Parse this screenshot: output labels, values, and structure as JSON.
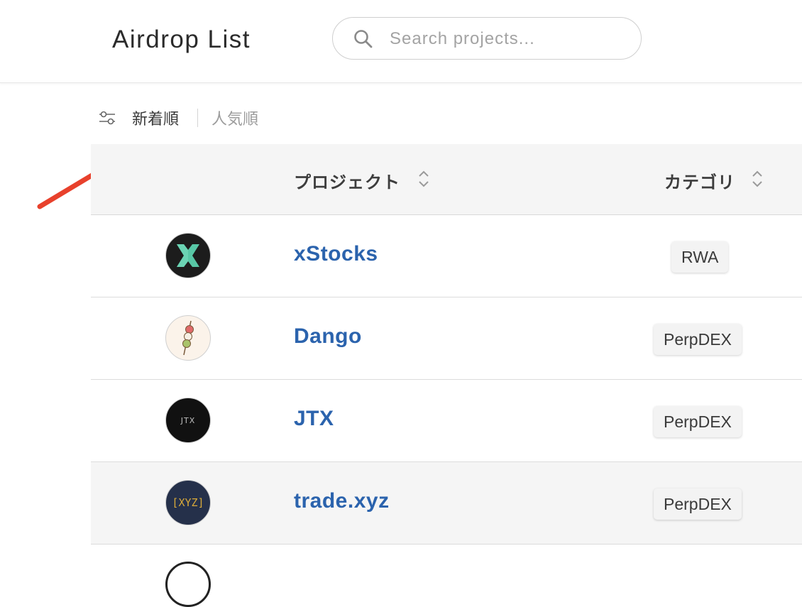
{
  "header": {
    "logo_text": "Airdrop List",
    "search_placeholder": "Search projects..."
  },
  "sort": {
    "newest_label": "新着順",
    "popular_label": "人気順"
  },
  "table": {
    "headers": {
      "project": "プロジェクト",
      "category": "カテゴリ"
    },
    "rows": [
      {
        "name": "xStocks",
        "category": "RWA",
        "logo": "xstocks-logo"
      },
      {
        "name": "Dango",
        "category": "PerpDEX",
        "logo": "dango-logo"
      },
      {
        "name": "JTX",
        "category": "PerpDEX",
        "logo": "jtx-logo",
        "logo_text": "JTX"
      },
      {
        "name": "trade.xyz",
        "category": "PerpDEX",
        "logo": "tradexyz-logo",
        "logo_text": "[XYZ]"
      }
    ]
  },
  "colors": {
    "link": "#2b63ad",
    "annotation_arrow": "#e8412c",
    "header_bg": "#f5f5f5"
  }
}
